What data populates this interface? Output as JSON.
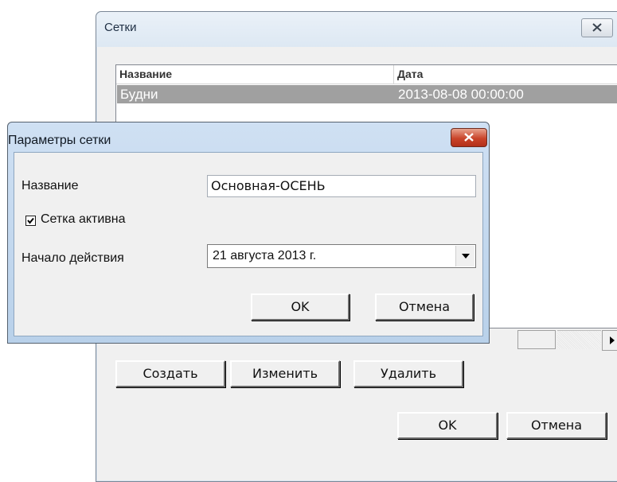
{
  "grids_window": {
    "title": "Сетки",
    "columns": [
      "Название",
      "Дата"
    ],
    "rows": [
      {
        "name": "Будни",
        "date": "2013-08-08 00:00:00"
      }
    ],
    "buttons": {
      "create": "Создать",
      "edit": "Изменить",
      "delete": "Удалить",
      "ok": "OK",
      "cancel": "Отмена"
    }
  },
  "params_dialog": {
    "title": "Параметры сетки",
    "name_label": "Название",
    "name_value": "Основная-ОСЕНЬ",
    "active_label": "Сетка активна",
    "active_checked": true,
    "start_label": "Начало действия",
    "start_value": "21  августа  2013 г.",
    "ok": "OK",
    "cancel": "Отмена"
  },
  "icons": {
    "close": "close-icon",
    "checkmark": "checkmark-icon",
    "dropdown": "chevron-down-icon",
    "scroll_right": "scroll-right-arrow-icon"
  },
  "colors": {
    "selected_row": "#a0a0a0",
    "dialog_frame": "#b9d1ea",
    "close_button_red": "#c9442a"
  }
}
